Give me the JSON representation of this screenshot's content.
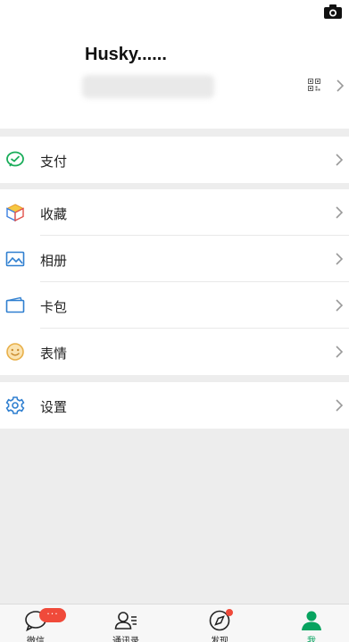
{
  "profile": {
    "name": "Husky......"
  },
  "menu": {
    "pay": "支付",
    "favorites": "收藏",
    "album": "相册",
    "cards": "卡包",
    "stickers": "表情",
    "settings": "设置"
  },
  "tabs": {
    "chats": {
      "label": "微信",
      "badge": "···"
    },
    "contacts": {
      "label": "通讯录"
    },
    "discover": {
      "label": "发现"
    },
    "me": {
      "label": "我"
    }
  },
  "colors": {
    "accent": "#07a35f",
    "badge": "#f04a3a",
    "pay_icon": "#1aad5a",
    "album_icon": "#2f7fd0",
    "cards_icon": "#2f7fd0",
    "stickers_icon": "#e8b04a",
    "settings_icon": "#2f7fd0"
  },
  "icons": {
    "camera": "camera-icon",
    "qr": "qr-code-icon",
    "pay": "wechat-pay-icon",
    "favorites": "cube-icon",
    "album": "image-icon",
    "cards": "wallet-icon",
    "stickers": "smile-icon",
    "settings": "gear-icon"
  }
}
